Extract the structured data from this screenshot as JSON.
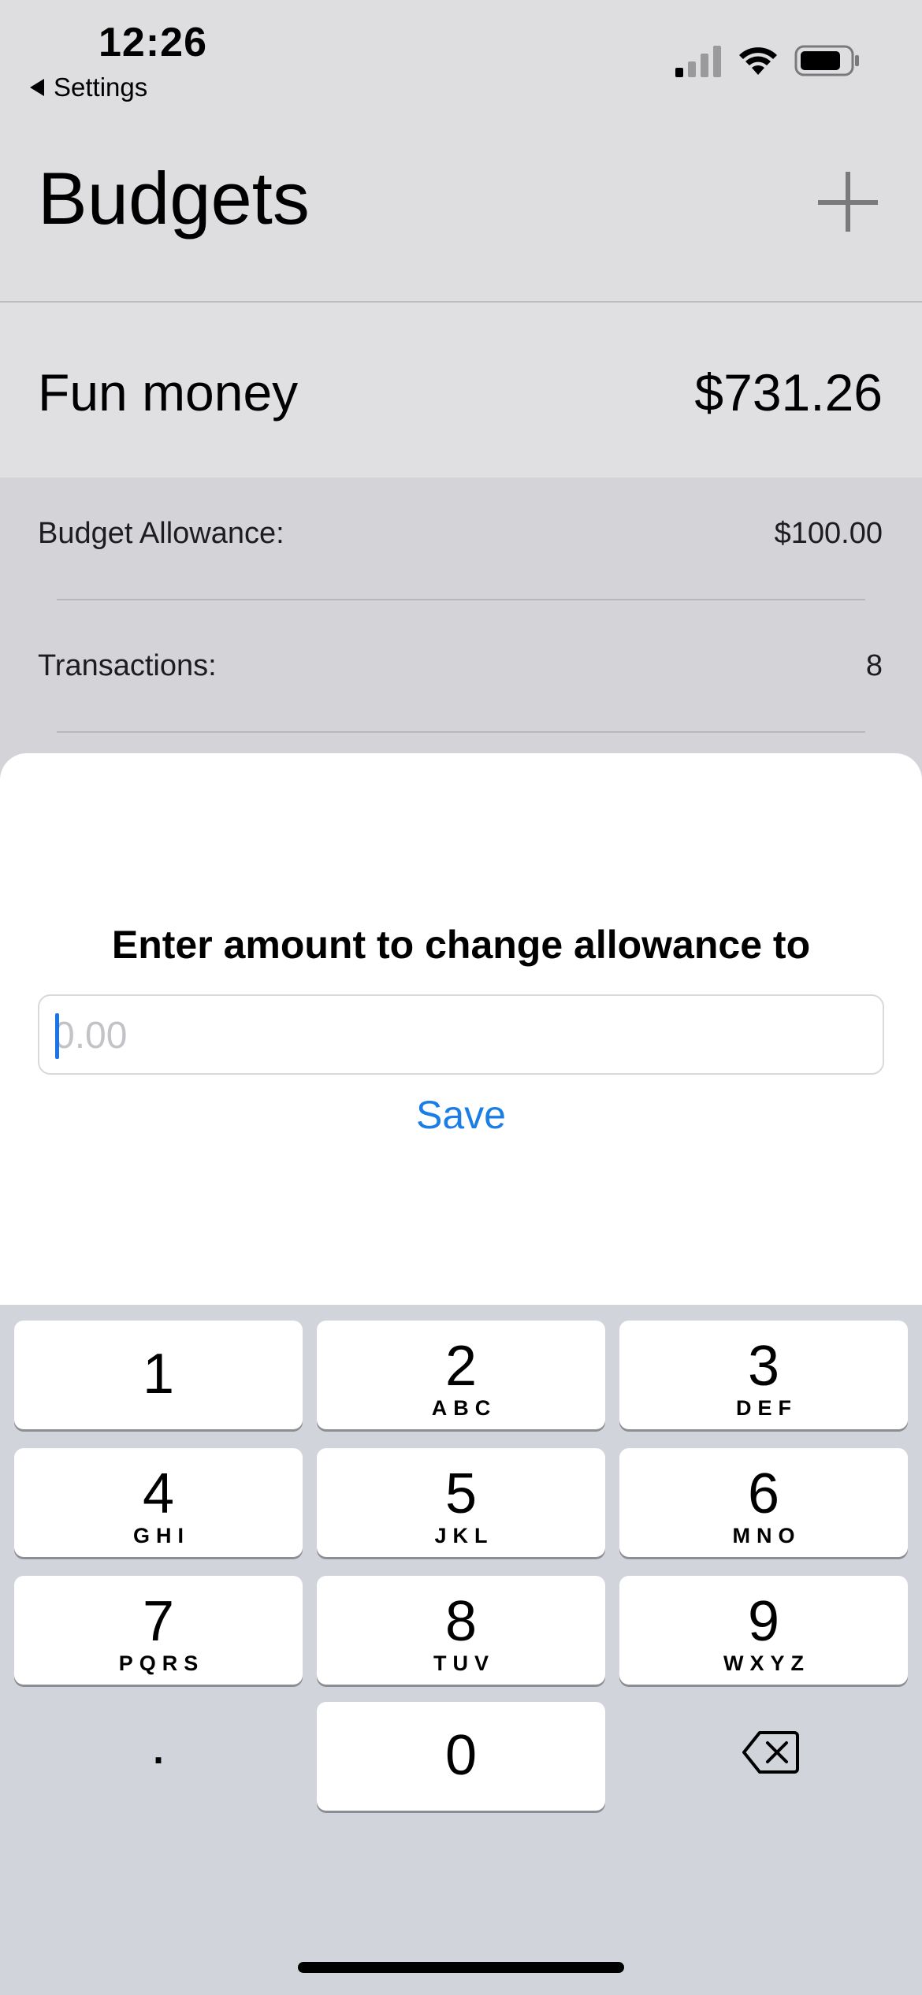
{
  "status_bar": {
    "time": "12:26",
    "back_label": "Settings",
    "icons": [
      "signal-icon",
      "wifi-icon",
      "battery-icon"
    ]
  },
  "nav": {
    "title": "Budgets",
    "add_icon": "plus-icon"
  },
  "budget": {
    "name": "Fun money",
    "amount": "$731.26"
  },
  "details": [
    {
      "label": "Budget Allowance:",
      "value": "$100.00"
    },
    {
      "label": "Transactions:",
      "value": "8"
    }
  ],
  "sheet": {
    "title": "Enter amount to change allowance to",
    "input_placeholder": "0.00",
    "input_value": "",
    "save_label": "Save"
  },
  "keyboard": {
    "keys": [
      {
        "num": "1",
        "letters": ""
      },
      {
        "num": "2",
        "letters": "ABC"
      },
      {
        "num": "3",
        "letters": "DEF"
      },
      {
        "num": "4",
        "letters": "GHI"
      },
      {
        "num": "5",
        "letters": "JKL"
      },
      {
        "num": "6",
        "letters": "MNO"
      },
      {
        "num": "7",
        "letters": "PQRS"
      },
      {
        "num": "8",
        "letters": "TUV"
      },
      {
        "num": "9",
        "letters": "WXYZ"
      },
      {
        "num": "0",
        "letters": ""
      }
    ],
    "decimal": ".",
    "delete_icon": "backspace-icon"
  },
  "colors": {
    "accent": "#1a7ee6",
    "keyboard_bg": "#d1d4db"
  }
}
